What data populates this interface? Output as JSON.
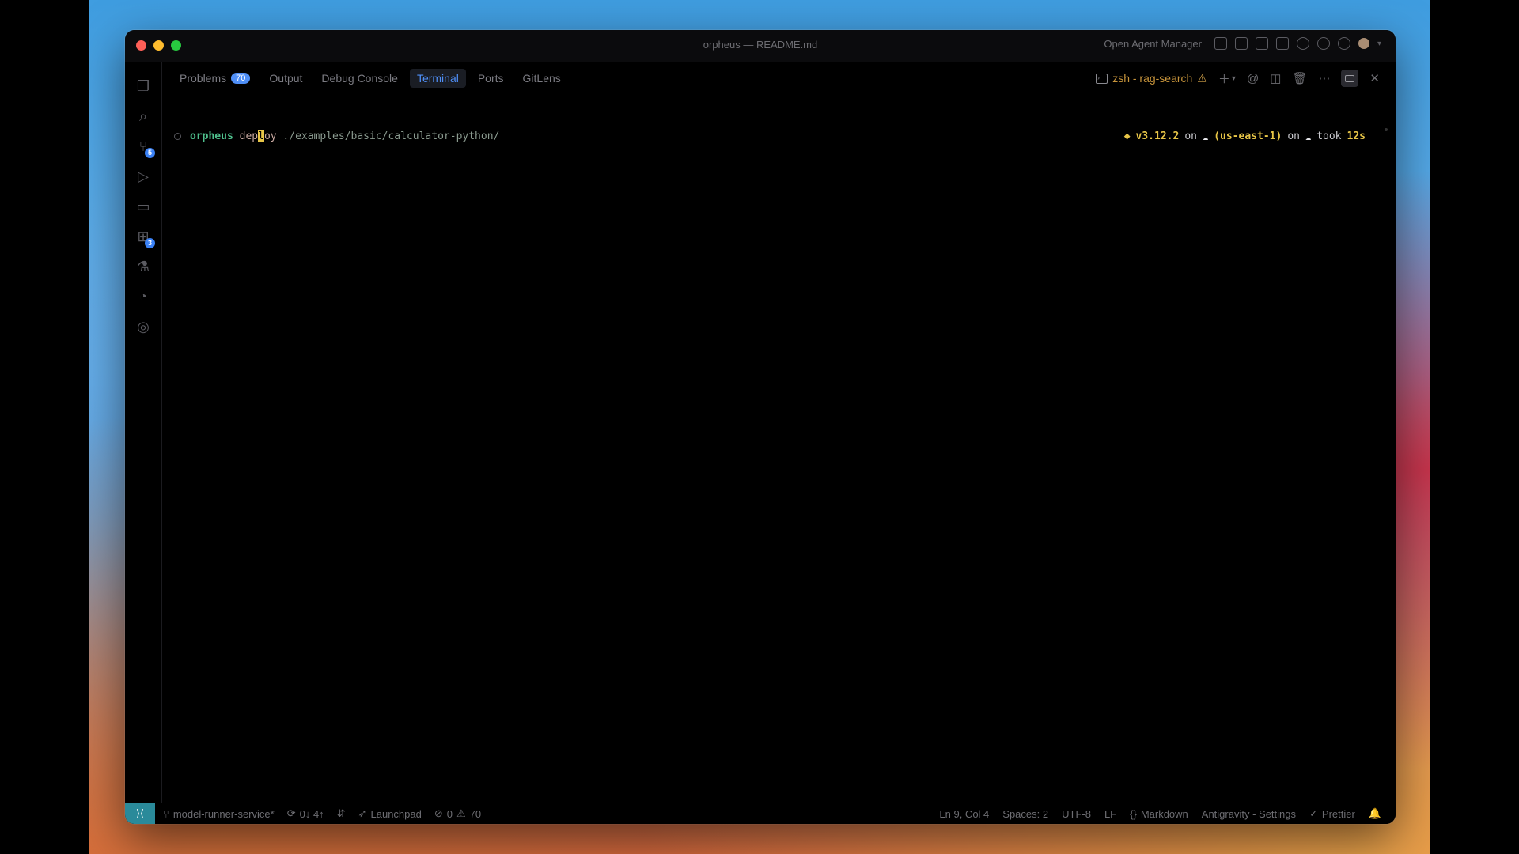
{
  "window": {
    "title": "orpheus — README.md"
  },
  "titlebar": {
    "agent_manager": "Open Agent Manager"
  },
  "activity_bar": {
    "source_control_badge": "5",
    "extensions_badge": "3"
  },
  "panel": {
    "tabs": [
      {
        "label": "Problems",
        "badge": "70"
      },
      {
        "label": "Output"
      },
      {
        "label": "Debug Console"
      },
      {
        "label": "Terminal",
        "active": true
      },
      {
        "label": "Ports"
      },
      {
        "label": "GitLens"
      }
    ],
    "terminal_name": "zsh - rag-search"
  },
  "terminal": {
    "command": "orpheus",
    "arg_before_cursor": "dep",
    "cursor_char": "l",
    "arg_after_cursor": "oy",
    "path": "./examples/basic/calculator-python/",
    "right_prompt": {
      "version": "v3.12.2",
      "on1": "on",
      "region": "(us-east-1)",
      "on2": "on",
      "took": "took",
      "duration": "12s"
    }
  },
  "statusbar": {
    "branch": "model-runner-service*",
    "sync": "0↓ 4↑",
    "launchpad": "Launchpad",
    "errors": "0",
    "warnings": "70",
    "position": "Ln 9, Col 4",
    "spaces": "Spaces: 2",
    "encoding": "UTF-8",
    "eol": "LF",
    "language": "Markdown",
    "settings": "Antigravity - Settings",
    "formatter": "Prettier"
  }
}
